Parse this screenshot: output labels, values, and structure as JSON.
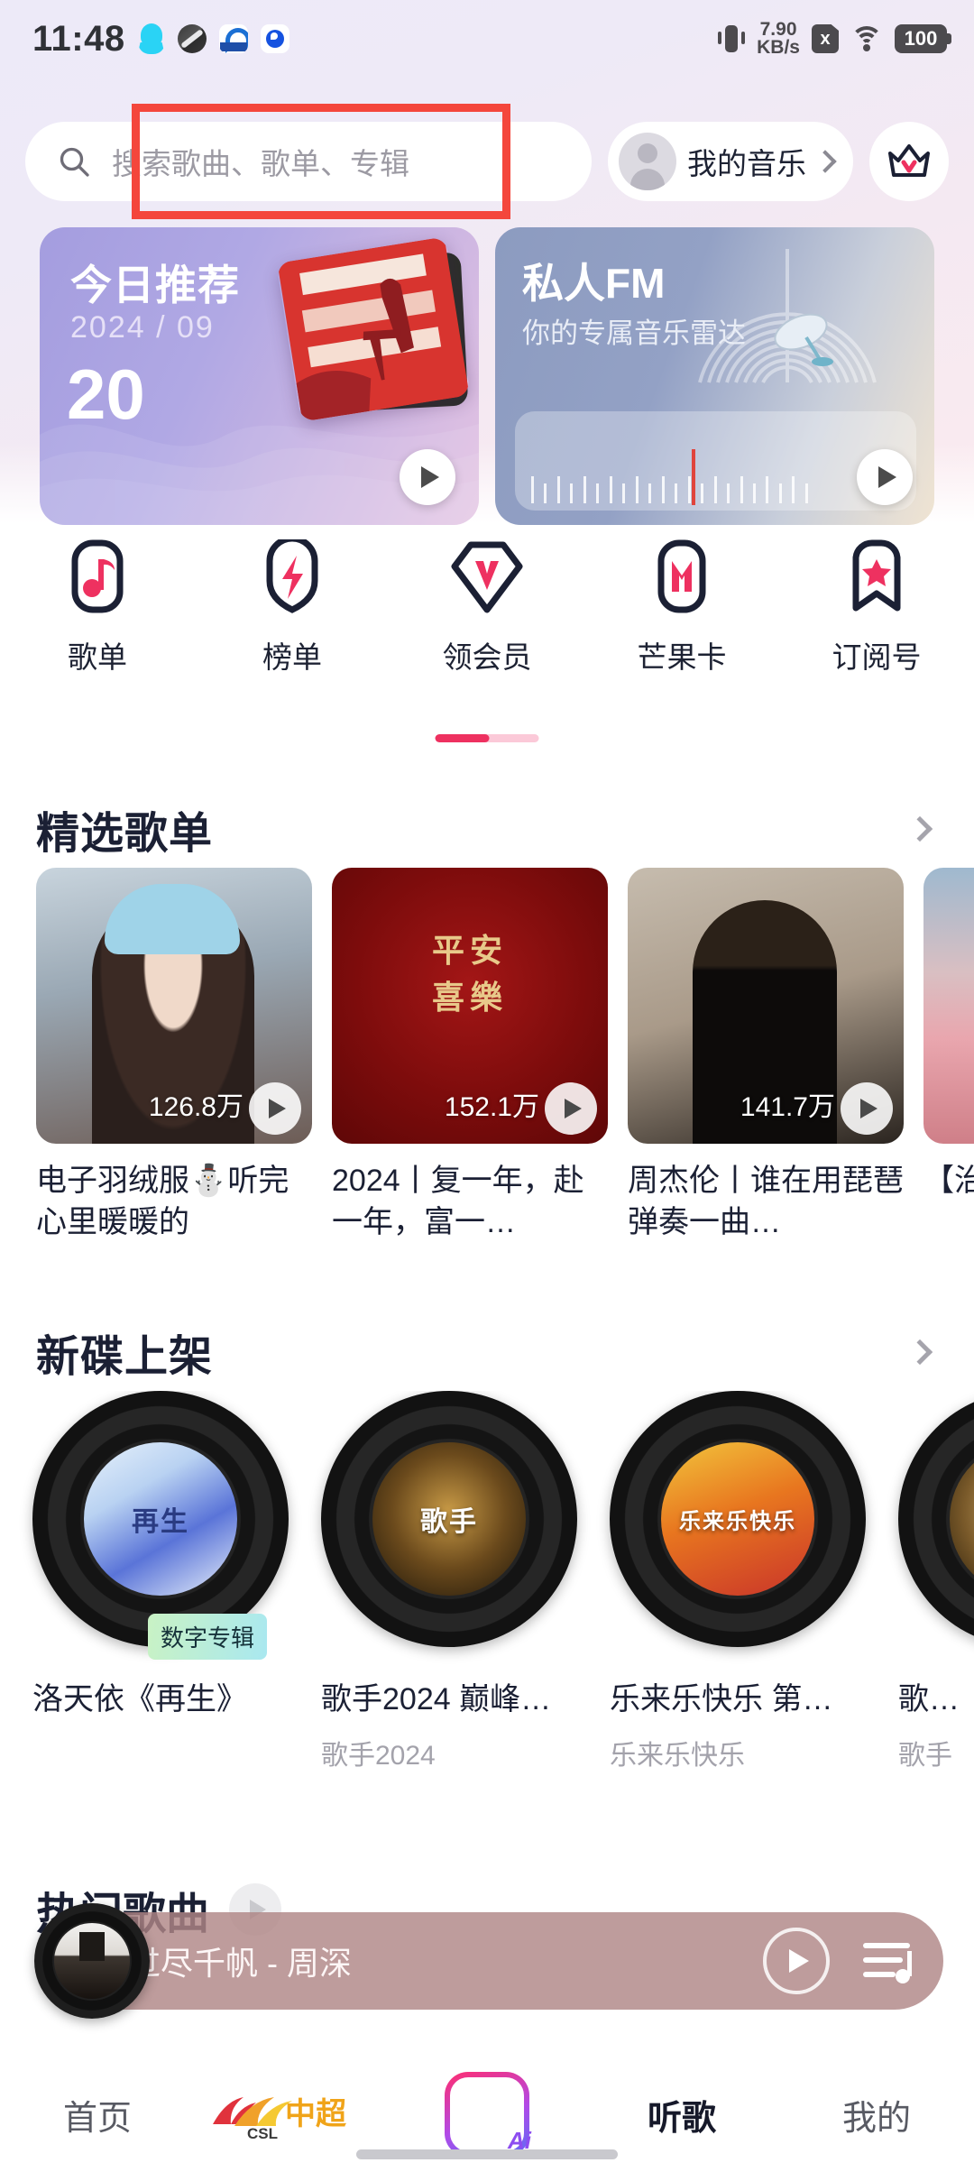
{
  "status_bar": {
    "time": "11:48",
    "network_speed": "7.90",
    "network_unit": "KB/s",
    "battery": "100",
    "sim_x": "x",
    "left_icons": [
      "qq-icon",
      "oval-app-icon",
      "blue-app-icon",
      "blue-circle-app-icon"
    ],
    "right_icons": [
      "vibrate-icon",
      "sim-card-x-icon",
      "wifi-icon",
      "battery-icon"
    ]
  },
  "search": {
    "placeholder": "搜索歌曲、歌单、专辑",
    "icon": "search-icon"
  },
  "header": {
    "my_music_label": "我的音乐",
    "my_music_chevron": "chevron-right-icon",
    "avatar_icon": "avatar-icon",
    "vip_icon": "crown-icon"
  },
  "annotation": {
    "color": "#f4463c",
    "target": "search-input"
  },
  "banners": [
    {
      "id": "today-recommend",
      "title": "今日推荐",
      "date": "2024 / 09",
      "day": "20",
      "play_icon": "play-icon"
    },
    {
      "id": "private-fm",
      "title": "私人FM",
      "subtitle": "你的专属音乐雷达",
      "play_icon": "play-icon"
    }
  ],
  "quick_nav": [
    {
      "label": "歌单",
      "icon": "music-note-icon"
    },
    {
      "label": "榜单",
      "icon": "lightning-icon"
    },
    {
      "label": "领会员",
      "icon": "vip-diamond-icon"
    },
    {
      "label": "芒果卡",
      "icon": "mango-card-icon"
    },
    {
      "label": "订阅号",
      "icon": "star-bookmark-icon"
    }
  ],
  "sections": {
    "playlists": {
      "title": "精选歌单",
      "chevron": "chevron-right-icon",
      "items": [
        {
          "title": "电子羽绒服⛄听完心里暖暖的",
          "plays": "126.8万",
          "play_icon": "play-icon"
        },
        {
          "title": "2024丨复一年，赴一年，富一…",
          "plays": "152.1万",
          "play_icon": "play-icon"
        },
        {
          "title": "周杰伦丨谁在用琵琶弹奏一曲…",
          "plays": "141.7万",
          "play_icon": "play-icon"
        },
        {
          "title": "【治的…",
          "plays": "",
          "play_icon": "play-icon"
        }
      ]
    },
    "albums": {
      "title": "新碟上架",
      "chevron": "chevron-right-icon",
      "items": [
        {
          "title": "洛天依《再生》",
          "subtitle": "",
          "badge": "数字专辑",
          "label_text": "再生"
        },
        {
          "title": "歌手2024 巅峰…",
          "subtitle": "歌手2024",
          "badge": "",
          "label_text": "歌手"
        },
        {
          "title": "乐来乐快乐 第…",
          "subtitle": "乐来乐快乐",
          "badge": "",
          "label_text": "乐来乐快乐"
        },
        {
          "title": "歌…",
          "subtitle": "歌手",
          "badge": "",
          "label_text": ""
        }
      ]
    },
    "hot_songs": {
      "title": "热门歌曲",
      "play_icon": "play-icon"
    }
  },
  "mini_player": {
    "now_playing": "过尽千帆 - 周深",
    "play_icon": "play-icon",
    "playlist_icon": "playlist-icon",
    "cover_icon": "vinyl-cover-icon"
  },
  "bottom_nav": [
    {
      "label": "首页",
      "icon": "home-tab",
      "active": false
    },
    {
      "label": "CSL中超",
      "icon": "csl-logo-icon",
      "active": false
    },
    {
      "label": "",
      "icon": "ai-add-icon",
      "active": false
    },
    {
      "label": "听歌",
      "icon": "listen-tab",
      "active": true
    },
    {
      "label": "我的",
      "icon": "mine-tab",
      "active": false
    }
  ],
  "colors": {
    "accent_pink": "#ee3160",
    "dark_navy": "#1b2034",
    "annotation_red": "#f4463c"
  }
}
